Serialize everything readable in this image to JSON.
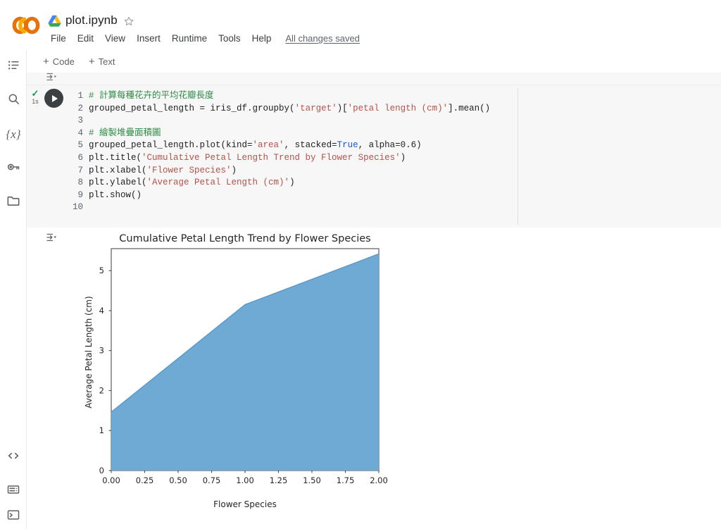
{
  "header": {
    "logo": "colab-logo",
    "drive_icon": "drive-icon",
    "notebook_title": "plot.ipynb",
    "star_icon": "star-icon",
    "menu": [
      "File",
      "Edit",
      "View",
      "Insert",
      "Runtime",
      "Tools",
      "Help"
    ],
    "save_state": "All changes saved"
  },
  "toolbar": {
    "add_code_label": "Code",
    "add_text_label": "Text",
    "plus": "+"
  },
  "rail": {
    "top_items": [
      {
        "name": "table-of-contents-icon",
        "label": "Table of contents"
      },
      {
        "name": "search-icon",
        "label": "Find and replace"
      },
      {
        "name": "variables-icon",
        "label": "{x}"
      },
      {
        "name": "secrets-key-icon",
        "label": "Secrets"
      },
      {
        "name": "files-folder-icon",
        "label": "Files"
      }
    ],
    "bottom_items": [
      {
        "name": "code-snippets-icon",
        "label": "Code snippets"
      },
      {
        "name": "command-palette-icon",
        "label": "Command palette"
      },
      {
        "name": "terminal-icon",
        "label": "Terminal"
      }
    ]
  },
  "cell": {
    "status_check": "✓",
    "exec_time": "1s",
    "run_button": "run-cell-button",
    "line_numbers": [
      "1",
      "2",
      "3",
      "4",
      "5",
      "6",
      "7",
      "8",
      "9",
      "10"
    ],
    "code_lines": [
      "# 計算每種花卉的平均花瓣長度",
      "grouped_petal_length = iris_df.groupby('target')['petal length (cm)'].mean()",
      "",
      "# 繪製堆疊面積圖",
      "grouped_petal_length.plot(kind='area', stacked=True, alpha=0.6)",
      "plt.title('Cumulative Petal Length Trend by Flower Species')",
      "plt.xlabel('Flower Species')",
      "plt.ylabel('Average Petal Length (cm)')",
      "plt.show()",
      ""
    ],
    "output_actions_icon": "output-actions-icon"
  },
  "chart_data": {
    "type": "area",
    "title": "Cumulative Petal Length Trend by Flower Species",
    "xlabel": "Flower Species",
    "ylabel": "Average Petal Length (cm)",
    "x": [
      0,
      1,
      2
    ],
    "values": [
      1.462,
      4.26,
      5.552
    ],
    "series": [
      {
        "name": "petal length (cm)",
        "values": [
          1.462,
          4.26,
          5.552
        ]
      }
    ],
    "xlim": [
      0,
      2
    ],
    "ylim": [
      0,
      5.552
    ],
    "xticks": [
      "0.00",
      "0.25",
      "0.50",
      "0.75",
      "1.00",
      "1.25",
      "1.50",
      "1.75",
      "2.00"
    ],
    "xtick_values": [
      0,
      0.25,
      0.5,
      0.75,
      1.0,
      1.25,
      1.5,
      1.75,
      2.0
    ],
    "yticks": [
      "0",
      "1",
      "2",
      "3",
      "4",
      "5"
    ],
    "ytick_values": [
      0,
      1,
      2,
      3,
      4,
      5
    ],
    "grid": false,
    "legend": "none",
    "alpha": 0.6,
    "fill_color": "#6faad4",
    "line_color": "#5596c8"
  }
}
